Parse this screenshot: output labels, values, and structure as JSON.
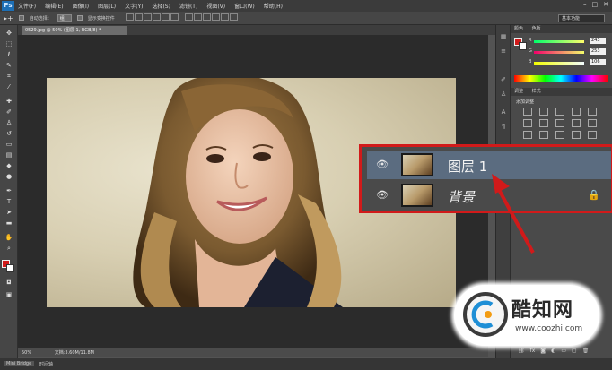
{
  "app": {
    "logo": "Ps",
    "menu": [
      "文件(F)",
      "编辑(E)",
      "图像(I)",
      "图层(L)",
      "文字(Y)",
      "选择(S)",
      "滤镜(T)",
      "视图(V)",
      "窗口(W)",
      "帮助(H)"
    ]
  },
  "options": {
    "auto_select_label": "自动选择：",
    "auto_select_value": "组",
    "show_transform_label": "显示变换控件",
    "workspace": "基本功能"
  },
  "document": {
    "tab_title": "0529.jpg @ 50% (图层 1, RGB/8) *",
    "zoom": "50%",
    "doc_info": "文档:3.60M/11.8M"
  },
  "color_panel": {
    "tab_color": "颜色",
    "tab_swatches": "色板",
    "r_label": "R",
    "g_label": "G",
    "b_label": "B",
    "r_value": "243",
    "g_value": "253",
    "b_value": "106"
  },
  "adjust_panel": {
    "tab_adjust": "调整",
    "tab_styles": "样式",
    "add_adjustment_label": "添加调整"
  },
  "layers": [
    {
      "name": "图层 1",
      "selected": true,
      "locked": false
    },
    {
      "name": "背景",
      "selected": false,
      "locked": true
    }
  ],
  "bottom_tabs": [
    "Mini Bridge",
    "时间轴"
  ],
  "watermark": {
    "title": "酷知网",
    "url": "www.coozhi.com"
  },
  "colors": {
    "accent_red": "#d11a1a",
    "selected_layer": "#5b6c80",
    "foreground_swatch": "#d11a1a",
    "background_swatch": "#ffffff"
  },
  "icons": [
    "move-tool-icon",
    "marquee-tool-icon",
    "lasso-tool-icon",
    "crop-tool-icon",
    "eyedropper-icon",
    "brush-icon",
    "stamp-icon",
    "eraser-icon",
    "gradient-icon",
    "pen-icon",
    "type-tool-icon",
    "hand-tool-icon",
    "zoom-tool-icon",
    "eye-icon",
    "lock-icon"
  ]
}
